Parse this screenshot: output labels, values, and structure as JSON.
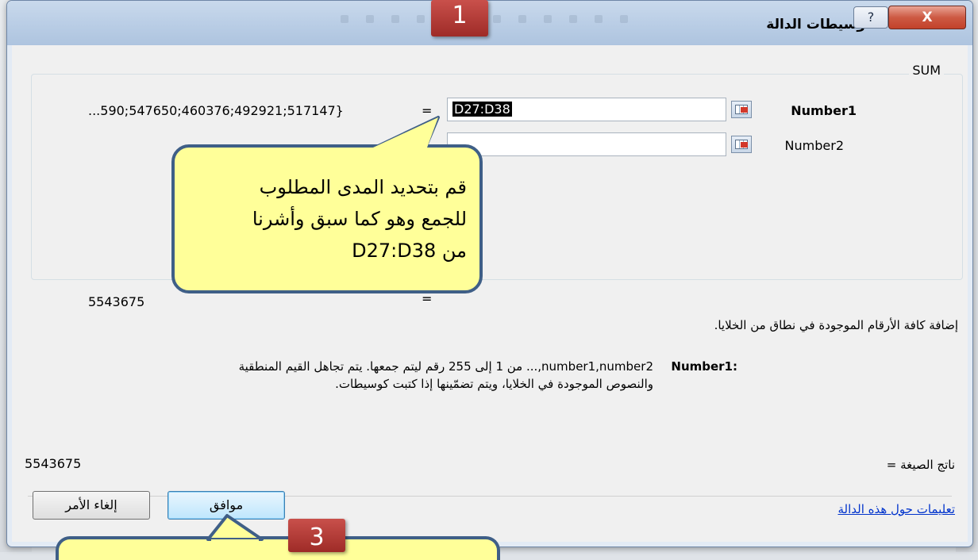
{
  "dialog": {
    "title": "وسيطات الدالة",
    "help_glyph": "?",
    "close_glyph": "X"
  },
  "function_name": "SUM",
  "args": [
    {
      "label": "Number1",
      "value": "D27:D38",
      "result": "...590;547650;460376;492921;517147}",
      "equals": "="
    },
    {
      "label": "Number2",
      "value": "",
      "result": "",
      "equals": ""
    }
  ],
  "total_value": "5543675",
  "total_equals": "=",
  "description": "إضافة كافة الأرقام الموجودة في نطاق من الخلايا.",
  "arg_help": {
    "label": ":Number1",
    "line1": "number1,number2,...  من 1 إلى 255 رقم ليتم جمعها. يتم تجاهل القيم المنطقية",
    "line2": "والنصوص الموجودة في الخلايا، ويتم تضمّينها إذا كتبت كوسيطات."
  },
  "formula_result": {
    "label": "ناتج الصيغة =",
    "value": "5543675"
  },
  "help_link": "تعليمات حول هذه الدالة",
  "buttons": {
    "ok": "موافق",
    "cancel": "إلغاء الأمر"
  },
  "callout": {
    "line1": "قم بتحديد المدى المطلوب",
    "line2": "للجمع وهو كما سبق وأشرنا",
    "line3": "من D27:D38"
  },
  "markers": {
    "m1": "1",
    "m3": "3"
  },
  "colors": {
    "callout_fill": "#ffff99",
    "callout_border": "#3f5f87",
    "marker": "#b23b36",
    "close_button": "#c94b33"
  }
}
